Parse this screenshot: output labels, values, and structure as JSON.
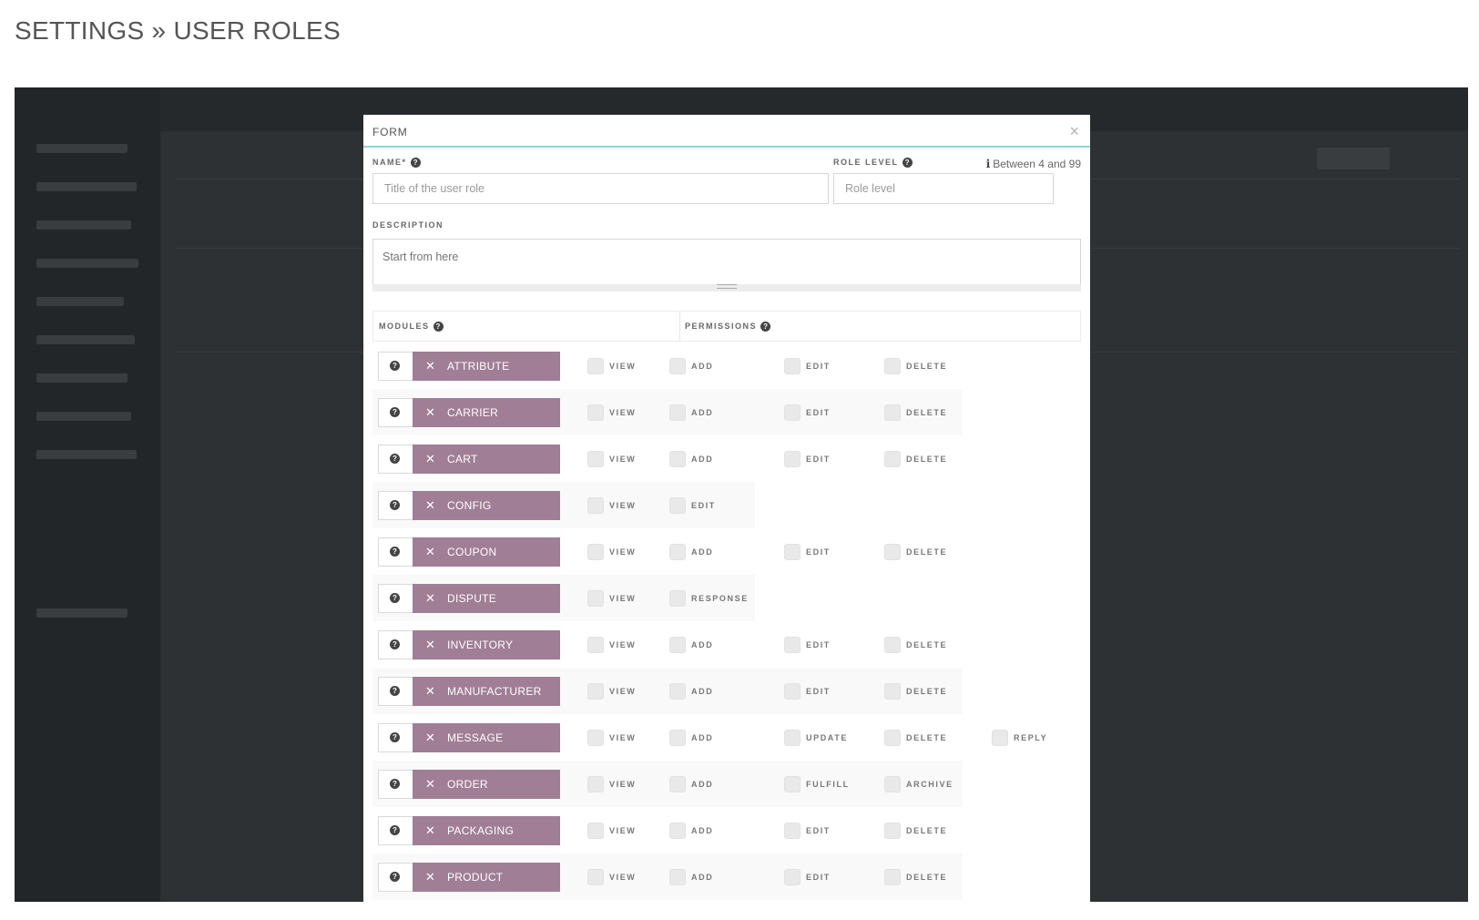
{
  "page": {
    "title": "SETTINGS » USER ROLES"
  },
  "form": {
    "title": "FORM",
    "close_label": "×",
    "name_label": "NAME*",
    "name_placeholder": "Title of the user role",
    "role_level_label": "ROLE LEVEL",
    "role_level_placeholder": "Role level",
    "role_level_hint": "Between 4 and 99",
    "description_label": "DESCRIPTION",
    "description_placeholder": "Start from here",
    "modules_header": "MODULES",
    "permissions_header": "PERMISSIONS"
  },
  "icons": {
    "help": "question-circle-icon",
    "info": "info-icon",
    "remove": "x-icon",
    "close": "close-icon"
  },
  "colors": {
    "module_tag": "#a07e95",
    "modal_accent": "#8fd3e0",
    "overlay": "#2e3134"
  },
  "modules": [
    {
      "label": "ATTRIBUTE",
      "permissions": [
        "VIEW",
        "ADD",
        "EDIT",
        "DELETE"
      ]
    },
    {
      "label": "CARRIER",
      "permissions": [
        "VIEW",
        "ADD",
        "EDIT",
        "DELETE"
      ]
    },
    {
      "label": "CART",
      "permissions": [
        "VIEW",
        "ADD",
        "EDIT",
        "DELETE"
      ]
    },
    {
      "label": "CONFIG",
      "permissions": [
        "VIEW",
        "EDIT"
      ]
    },
    {
      "label": "COUPON",
      "permissions": [
        "VIEW",
        "ADD",
        "EDIT",
        "DELETE"
      ]
    },
    {
      "label": "DISPUTE",
      "permissions": [
        "VIEW",
        "RESPONSE"
      ]
    },
    {
      "label": "INVENTORY",
      "permissions": [
        "VIEW",
        "ADD",
        "EDIT",
        "DELETE"
      ]
    },
    {
      "label": "MANUFACTURER",
      "permissions": [
        "VIEW",
        "ADD",
        "EDIT",
        "DELETE"
      ]
    },
    {
      "label": "MESSAGE",
      "permissions": [
        "VIEW",
        "ADD",
        "UPDATE",
        "DELETE",
        "REPLY"
      ]
    },
    {
      "label": "ORDER",
      "permissions": [
        "VIEW",
        "ADD",
        "FULFILL",
        "ARCHIVE"
      ]
    },
    {
      "label": "PACKAGING",
      "permissions": [
        "VIEW",
        "ADD",
        "EDIT",
        "DELETE"
      ]
    },
    {
      "label": "PRODUCT",
      "permissions": [
        "VIEW",
        "ADD",
        "EDIT",
        "DELETE"
      ]
    }
  ]
}
